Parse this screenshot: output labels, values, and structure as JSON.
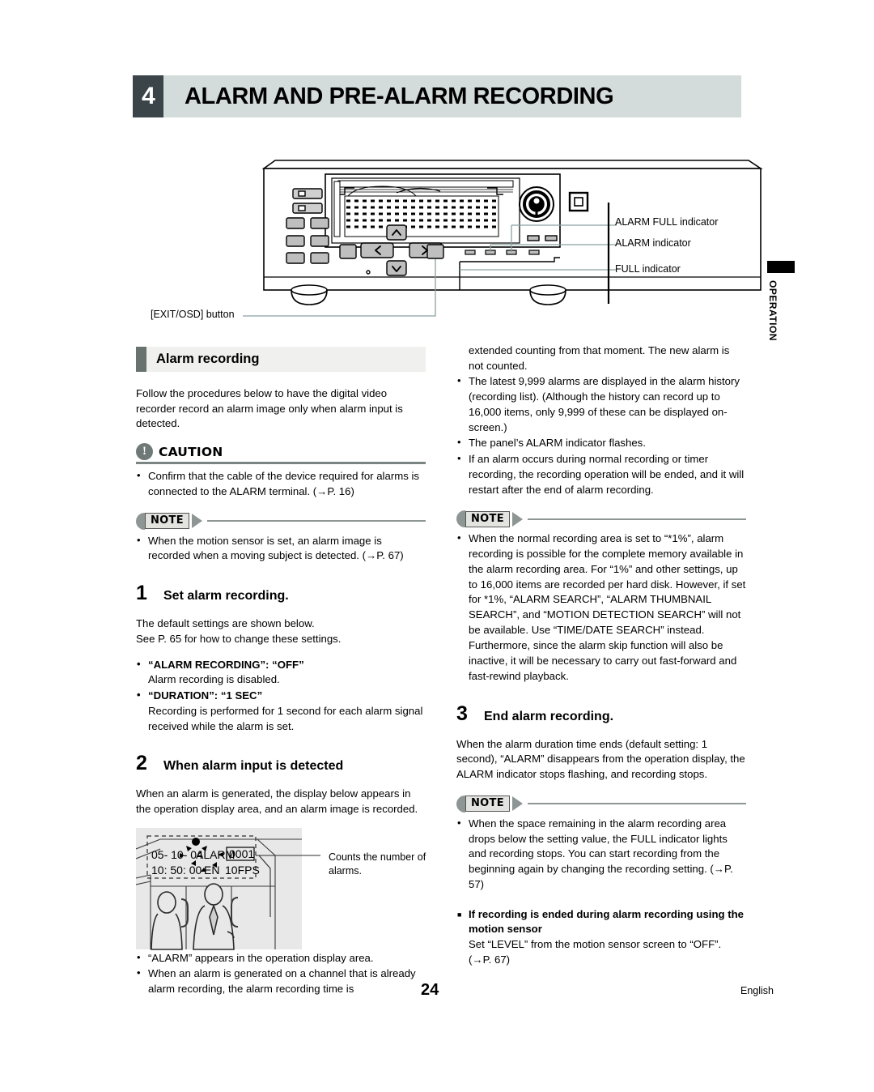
{
  "chapter": {
    "number": "4",
    "title": "ALARM AND PRE-ALARM RECORDING"
  },
  "side_tab": {
    "label": "OPERATION"
  },
  "figure_callouts": {
    "alarm_full_indicator": "ALARM FULL indicator",
    "alarm_indicator": "ALARM indicator",
    "full_indicator": "FULL indicator",
    "exit_osd_button": "[EXIT/OSD] button"
  },
  "left_column": {
    "section_heading": "Alarm recording",
    "intro": "Follow the procedures below to have the digital video recorder record an alarm image only when alarm input is detected.",
    "caution": {
      "label": "CAUTION",
      "icon": "exclamation-icon",
      "items": [
        "Confirm that the cable of the device required for alarms is connected to the ALARM terminal. (→P. 16)"
      ]
    },
    "note1": {
      "label": "NOTE",
      "items": [
        "When the motion sensor is set, an alarm image is recorded when a moving subject is detected. (→P. 67)"
      ]
    },
    "step1": {
      "number": "1",
      "title": "Set alarm recording.",
      "body_line1": "The default settings are shown below.",
      "body_line2": "See P. 65 for how to change these settings.",
      "settings": [
        {
          "name": "“ALARM RECORDING”: “OFF”",
          "desc": "Alarm recording is disabled."
        },
        {
          "name": "“DURATION”: “1 SEC”",
          "desc": "Recording is performed for 1 second for each alarm signal received while the alarm is set."
        }
      ]
    },
    "step2": {
      "number": "2",
      "title": "When alarm input is detected",
      "body": "When an alarm is generated, the display below appears in the operation display area, and an alarm image is recorded."
    },
    "osd_figure": {
      "date": "05- 10- 04",
      "alarm_text": "ALARM",
      "counter": "0001",
      "time": "10: 50: 00",
      "mode": "EN",
      "fps": "10FPS",
      "caption": "Counts the number of alarms."
    },
    "after_figure_items": [
      "“ALARM” appears in the operation display area.",
      "When an alarm is generated on a channel that is already alarm recording, the alarm recording time is"
    ]
  },
  "right_column": {
    "continued_text": "extended counting from that moment. The new alarm is not counted.",
    "top_items": [
      "The latest 9,999 alarms are displayed in the alarm history (recording list). (Although the history can record up to 16,000 items, only 9,999 of these can be displayed on-screen.)",
      "The panel’s ALARM indicator flashes.",
      "If an alarm occurs during normal recording or timer recording, the recording operation will be ended, and it will restart after the end of alarm recording."
    ],
    "note2": {
      "label": "NOTE",
      "items": [
        "When the normal recording area is set to “*1%”, alarm recording is possible for the complete memory available in the alarm recording area. For “1%” and other settings, up to 16,000 items are recorded per hard disk. However, if set for *1%, “ALARM SEARCH”, “ALARM THUMBNAIL SEARCH”, and “MOTION DETECTION SEARCH” will not be available. Use “TIME/DATE SEARCH” instead."
      ],
      "trailing_paragraph": "Furthermore, since the alarm skip function will also be inactive, it will be necessary to carry out fast-forward and fast-rewind playback."
    },
    "step3": {
      "number": "3",
      "title": "End alarm recording.",
      "body": "When the alarm duration time ends (default setting: 1 second), “ALARM” disappears from the operation display, the ALARM indicator stops flashing, and recording stops."
    },
    "note3": {
      "label": "NOTE",
      "items": [
        "When the space remaining in the alarm recording area drops below the setting value, the FULL indicator lights and recording stops. You can start recording from the beginning again by changing the recording setting. (→P. 57)"
      ]
    },
    "subsection": {
      "heading_line1": "If recording is ended during alarm recording",
      "heading_line2": "using the motion sensor",
      "body_line1": "Set “LEVEL” from the motion sensor screen to “OFF”.",
      "body_line2": "(→P. 67)"
    }
  },
  "footer": {
    "page_number": "24",
    "language": "English"
  },
  "colors": {
    "chapter_num_bg": "#3b4449",
    "chapter_title_bg": "#d3dcda",
    "section_tab": "#68736f",
    "section_bg": "#f0f0ee",
    "leader_line": "#8aa0a0",
    "note_gray": "#8d9694"
  }
}
